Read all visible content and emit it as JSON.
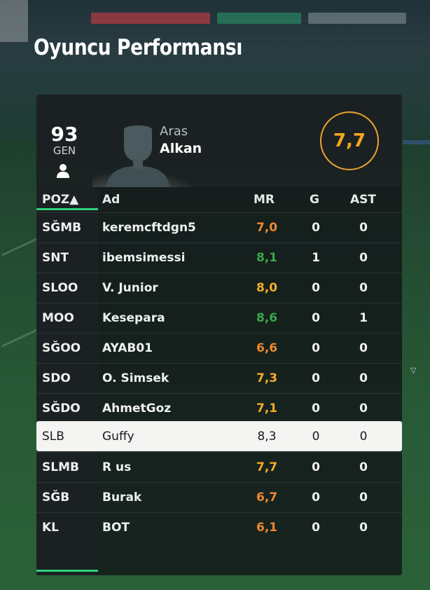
{
  "page": {
    "title": "Oyuncu Performansı"
  },
  "player": {
    "rating": "93",
    "rating_label": "GEN",
    "first_name": "Aras",
    "last_name": "Alkan",
    "match_rating": "7,7"
  },
  "table": {
    "columns": {
      "poz": "POZ▲",
      "ad": "Ad",
      "mr": "MR",
      "g": "G",
      "ast": "AST"
    },
    "rows": [
      {
        "poz": "SĞMB",
        "name": "keremcftdgn5",
        "mr": "7,0",
        "g": "0",
        "ast": "0",
        "mr_color": "#f0882f"
      },
      {
        "poz": "SNT",
        "name": "ibemsimessi",
        "mr": "8,1",
        "g": "1",
        "ast": "0",
        "mr_color": "#3aa84a"
      },
      {
        "poz": "SLOO",
        "name": "V. Junior",
        "mr": "8,0",
        "g": "0",
        "ast": "0",
        "mr_color": "#f4ad26"
      },
      {
        "poz": "MOO",
        "name": "Kesepara",
        "mr": "8,6",
        "g": "0",
        "ast": "1",
        "mr_color": "#3aa84a"
      },
      {
        "poz": "SĞOO",
        "name": "AYAB01",
        "mr": "6,6",
        "g": "0",
        "ast": "0",
        "mr_color": "#f0882f"
      },
      {
        "poz": "SDO",
        "name": "O. Simsek",
        "mr": "7,3",
        "g": "0",
        "ast": "0",
        "mr_color": "#f4ad26"
      },
      {
        "poz": "SĞDO",
        "name": "AhmetGoz",
        "mr": "7,1",
        "g": "0",
        "ast": "0",
        "mr_color": "#f4ad26"
      },
      {
        "poz": "SLB",
        "name": "Guffy",
        "mr": "8,3",
        "g": "0",
        "ast": "0",
        "mr_color": "#1a1a1a",
        "selected": true
      },
      {
        "poz": "SLMB",
        "name": "R us",
        "mr": "7,7",
        "g": "0",
        "ast": "0",
        "mr_color": "#f4ad26"
      },
      {
        "poz": "SĞB",
        "name": "Burak",
        "mr": "6,7",
        "g": "0",
        "ast": "0",
        "mr_color": "#f0882f"
      },
      {
        "poz": "KL",
        "name": "BOT",
        "mr": "6,1",
        "g": "0",
        "ast": "0",
        "mr_color": "#f0882f"
      }
    ]
  },
  "colors": {
    "accent_green": "#2fd07b",
    "rating_ring": "#e8a32b",
    "rating_text": "#f5a623"
  }
}
